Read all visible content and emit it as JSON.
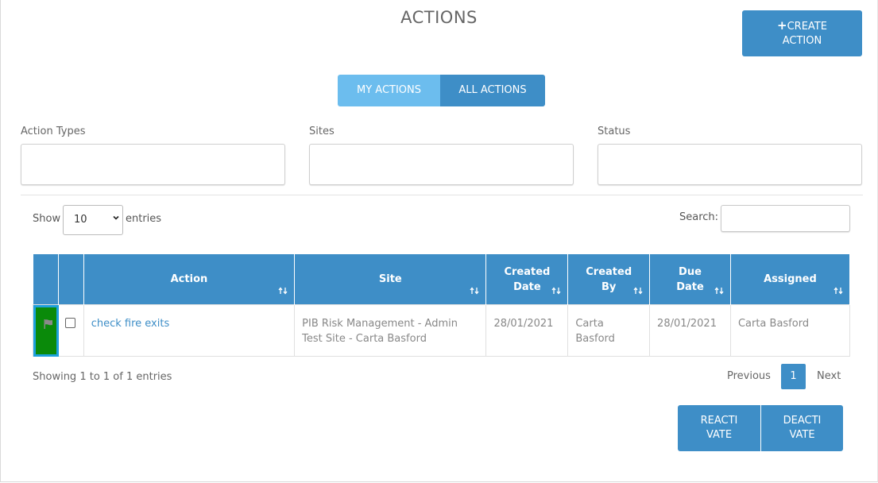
{
  "header": {
    "title": "ACTIONS",
    "create_plus": "+",
    "create_label_1": "CREATE",
    "create_label_2": "ACTION"
  },
  "toggle": {
    "my_actions": "MY ACTIONS",
    "all_actions": "ALL ACTIONS"
  },
  "filters": {
    "action_types": "Action Types",
    "sites": "Sites",
    "status": "Status"
  },
  "length": {
    "show": "Show",
    "value": "10",
    "entries": "entries"
  },
  "search": {
    "label": "Search:"
  },
  "table": {
    "headers": {
      "action": "Action",
      "site": "Site",
      "created_date_1": "Created",
      "created_date_2": "Date",
      "created_by_1": "Created",
      "created_by_2": "By",
      "due_date_1": "Due",
      "due_date_2": "Date",
      "assigned": "Assigned"
    },
    "rows": [
      {
        "action": "check fire exits",
        "site": "PIB Risk Management - Admin Test Site - Carta Basford",
        "created_date": "28/01/2021",
        "created_by": "Carta Basford",
        "due_date": "28/01/2021",
        "assigned": "Carta Basford"
      }
    ]
  },
  "pagination": {
    "info": "Showing 1 to 1 of 1 entries",
    "previous": "Previous",
    "page": "1",
    "next": "Next"
  },
  "buttons": {
    "reactivate": "REACTIVATE",
    "deactivate": "DEACTIVATE"
  },
  "colors": {
    "primary": "#3e8ec7",
    "toggle_light": "#6cbdee",
    "flag_bg": "#0a8a0a",
    "flag_outline": "#1ea0dc"
  }
}
